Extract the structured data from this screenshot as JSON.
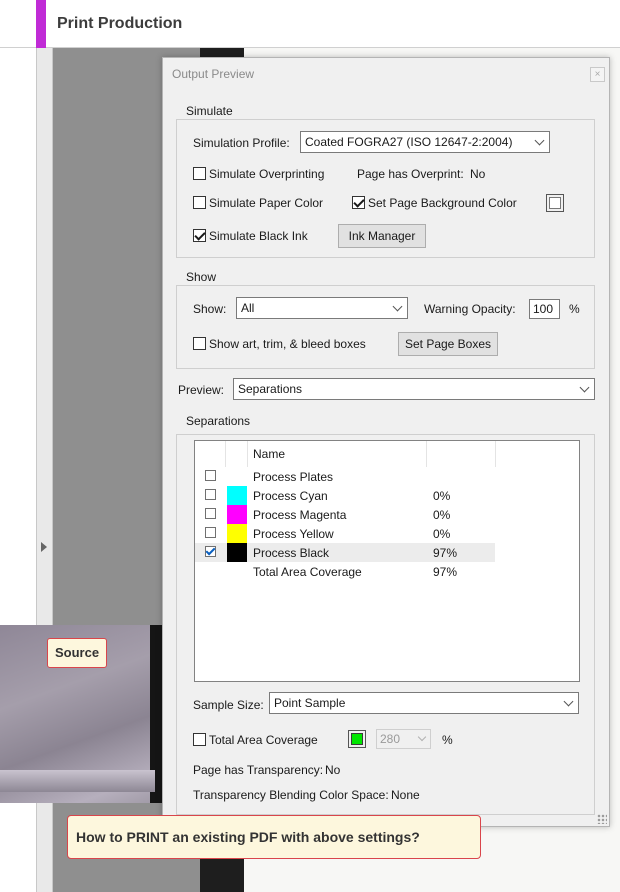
{
  "app": {
    "title": "Print Production"
  },
  "dialog": {
    "title": "Output Preview",
    "close_label": "×",
    "simulate": {
      "group_label": "Simulate",
      "profile_label": "Simulation Profile:",
      "profile_value": "Coated FOGRA27 (ISO 12647-2:2004)",
      "overprinting_label": "Simulate Overprinting",
      "overprinting_checked": false,
      "page_overprint_label": "Page has Overprint:",
      "page_overprint_value": "No",
      "paper_color_label": "Simulate Paper Color",
      "paper_color_checked": false,
      "bg_color_label": "Set Page Background Color",
      "bg_color_checked": true,
      "black_ink_label": "Simulate Black Ink",
      "black_ink_checked": true,
      "ink_manager_label": "Ink Manager"
    },
    "show": {
      "group_label": "Show",
      "show_label": "Show:",
      "show_value": "All",
      "warning_opacity_label": "Warning Opacity:",
      "warning_opacity_value": "100",
      "percent": "%",
      "boxes_label": "Show art, trim, & bleed boxes",
      "boxes_checked": false,
      "page_boxes_button": "Set Page Boxes"
    },
    "preview": {
      "label": "Preview:",
      "value": "Separations"
    },
    "separations": {
      "group_label": "Separations",
      "header_name": "Name",
      "rows": [
        {
          "name": "Process Plates",
          "value": "",
          "checked": false,
          "color": ""
        },
        {
          "name": "Process Cyan",
          "value": "0%",
          "checked": false,
          "color": "#00ffff"
        },
        {
          "name": "Process Magenta",
          "value": "0%",
          "checked": false,
          "color": "#ff00ff"
        },
        {
          "name": "Process Yellow",
          "value": "0%",
          "checked": false,
          "color": "#ffff00"
        },
        {
          "name": "Process Black",
          "value": "97%",
          "checked": true,
          "color": "#000000"
        },
        {
          "name": "Total Area Coverage",
          "value": "97%",
          "checked": false,
          "color": ""
        }
      ],
      "sample_size_label": "Sample Size:",
      "sample_size_value": "Point Sample",
      "tac_label": "Total Area Coverage",
      "tac_checked": false,
      "tac_color": "#00e600",
      "tac_value": "280",
      "tac_percent": "%",
      "transparency_label": "Page has Transparency:",
      "transparency_value": "No",
      "blending_label": "Transparency Blending Color Space:",
      "blending_value": "None"
    }
  },
  "overlay": {
    "source_label": "Source",
    "question": "How to PRINT an existing PDF with above settings?"
  },
  "colors": {
    "accent": "#c02bd6",
    "annotation_border": "#d9454b",
    "annotation_bg": "#fdf7dd"
  }
}
